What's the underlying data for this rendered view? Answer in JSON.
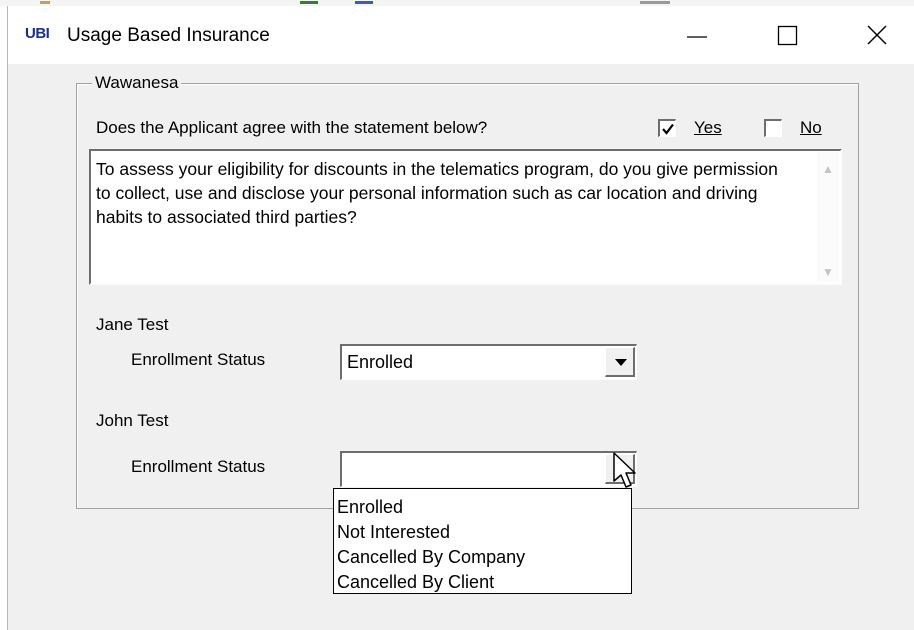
{
  "window": {
    "icon_text": "UBI",
    "title": "Usage Based Insurance"
  },
  "group": {
    "label": "Wawanesa",
    "question": "Does the Applicant agree with the statement below?",
    "yes_label": "Yes",
    "no_label": "No",
    "yes_checked": true,
    "no_checked": false,
    "statement": "To assess your eligibility for discounts in the telematics program, do you give permission to collect, use and disclose your personal information such as car location and driving habits to associated third parties?"
  },
  "applicants": [
    {
      "name": "Jane Test",
      "field_label": "Enrollment Status",
      "value": "Enrolled"
    },
    {
      "name": "John Test",
      "field_label": "Enrollment Status",
      "value": ""
    }
  ],
  "dropdown": {
    "options": [
      "Enrolled",
      "Not Interested",
      "Cancelled By Company",
      "Cancelled By Client"
    ]
  }
}
